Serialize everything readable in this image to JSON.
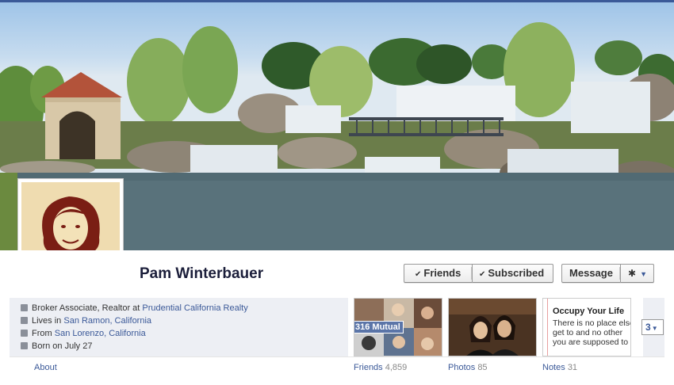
{
  "profile": {
    "name": "Pam Winterbauer"
  },
  "actions": {
    "friends_label": "Friends",
    "subscribed_label": "Subscribed",
    "message_label": "Message",
    "check_glyph": "✔",
    "gear_glyph": "✱",
    "caret_glyph": "▼"
  },
  "info": {
    "work_prefix": "Broker Associate, Realtor at ",
    "work_link": "Prudential California Realty",
    "lives_prefix": "Lives in ",
    "lives_link": "San Ramon, California",
    "from_prefix": "From ",
    "from_link": "San Lorenzo, California",
    "born": "Born on July 27"
  },
  "nav": {
    "about": "About",
    "friends_label": "Friends",
    "friends_count": "4,859",
    "photos_label": "Photos",
    "photos_count": "85",
    "notes_label": "Notes",
    "notes_count": "31",
    "mutual_badge": "316 Mutual",
    "more_count": "3"
  },
  "notes_preview": {
    "title": "Occupy Your Life",
    "lines": [
      "There is no place else",
      "get to  and no other",
      "you are supposed to"
    ]
  },
  "colors": {
    "brand": "#3b5998",
    "info_bg": "#edeff4"
  },
  "icons": {
    "work": "briefcase-icon",
    "lives": "home-icon",
    "from": "location-icon",
    "born": "calendar-icon"
  }
}
